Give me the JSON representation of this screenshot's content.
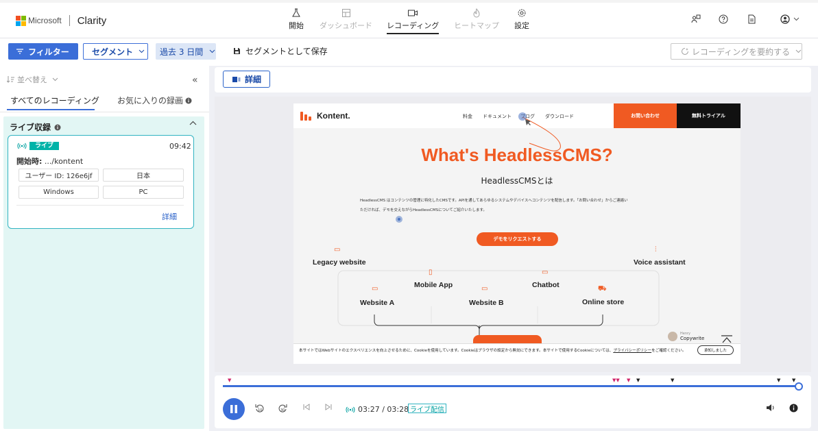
{
  "brand": {
    "company": "Microsoft",
    "app": "Clarity",
    "colors": {
      "accent": "#3b6ed8",
      "live": "#00b3a8",
      "site_orange": "#f05a22"
    }
  },
  "nav": {
    "items": [
      {
        "label": "開始",
        "icon": "flask-icon",
        "state": "normal"
      },
      {
        "label": "ダッシュボード",
        "icon": "dashboard-icon",
        "state": "disabled"
      },
      {
        "label": "レコーディング",
        "icon": "video-icon",
        "state": "active"
      },
      {
        "label": "ヒートマップ",
        "icon": "heatmap-icon",
        "state": "disabled"
      },
      {
        "label": "設定",
        "icon": "gear-icon",
        "state": "normal"
      }
    ]
  },
  "toolbar": {
    "filter": "フィルター",
    "segment": "セグメント",
    "date_range": "過去 3 日間",
    "save_segment": "セグメントとして保存",
    "summarize": "レコーディングを要約する"
  },
  "left": {
    "sort": "並べ替え",
    "tabs": {
      "all": "すべてのレコーディング",
      "favorites": "お気に入りの録画"
    },
    "live_section": "ライブ収録",
    "card": {
      "live_tag": "ライブ",
      "time": "09:42",
      "start_label": "開始時:",
      "start_value": ".../kontent",
      "user_id": "ユーザー ID: 126e6jf",
      "country": "日本",
      "os": "Windows",
      "device": "PC",
      "detail": "詳細"
    }
  },
  "main": {
    "detail_button": "詳細"
  },
  "site": {
    "brand": "Kontent.",
    "nav": [
      "料金",
      "ドキュメント",
      "ブログ",
      "ダウンロード"
    ],
    "contact": "お問い合わせ",
    "trial": "無料トライアル",
    "hero": "What's HeadlessCMS?",
    "subtitle": "HeadlessCMSとは",
    "desc1": "HeadlessCMS はコンテンツの管理に特化したCMSです。APIを通してあらゆるシステムやデバイスへコンテンツを配信します。「お問い合わせ」からご連絡い",
    "desc2": "ただければ、デモを交えながらHeadlessCMSについてご紹介いたします。",
    "demo": "デモをリクエストする",
    "diagram": {
      "legacy": "Legacy website",
      "mobile": "Mobile App",
      "chatbot": "Chatbot",
      "voice": "Voice assistant",
      "website_a": "Website A",
      "website_b": "Website B",
      "store": "Online store"
    },
    "chat_name": "Henry",
    "chat_role": "Copywrite",
    "cookie_text": "本サイトではWebサイトのエクスペリエンスを向上させるために、Cookieを使用しています。Cookieはブラウザの設定から無効にできます。本サイトで使用するCookieについては、",
    "cookie_link": "プライバシーポリシー",
    "cookie_text_end": "をご確認ください。",
    "cookie_ok": "承知しました"
  },
  "player": {
    "time": "03:27 / 03:28",
    "live": "ライブ配信",
    "progress_fraction": 0.995
  }
}
